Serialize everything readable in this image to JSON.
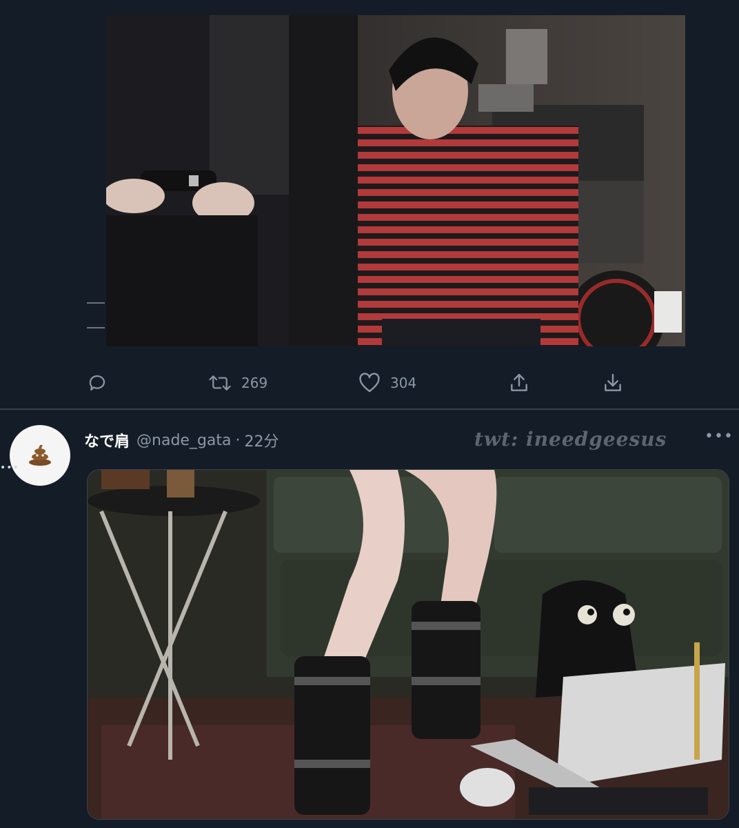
{
  "tweet_top": {
    "actions": {
      "reply_count": "",
      "retweet_count": "269",
      "like_count": "304"
    },
    "icons": [
      "reply-icon",
      "retweet-icon",
      "like-icon",
      "share-icon",
      "download-icon"
    ]
  },
  "tweet_bottom": {
    "display_name": "なで肩",
    "handle": "@nade_gata",
    "separator": "·",
    "time": "22分",
    "more": "•••",
    "thread_dots": "•••",
    "avatar_icon": "poop-emoji-icon"
  },
  "watermark": "twt: ineedgeesus",
  "colors": {
    "background": "#141d27",
    "text_secondary": "#8b98a5",
    "divider": "#38444d"
  }
}
